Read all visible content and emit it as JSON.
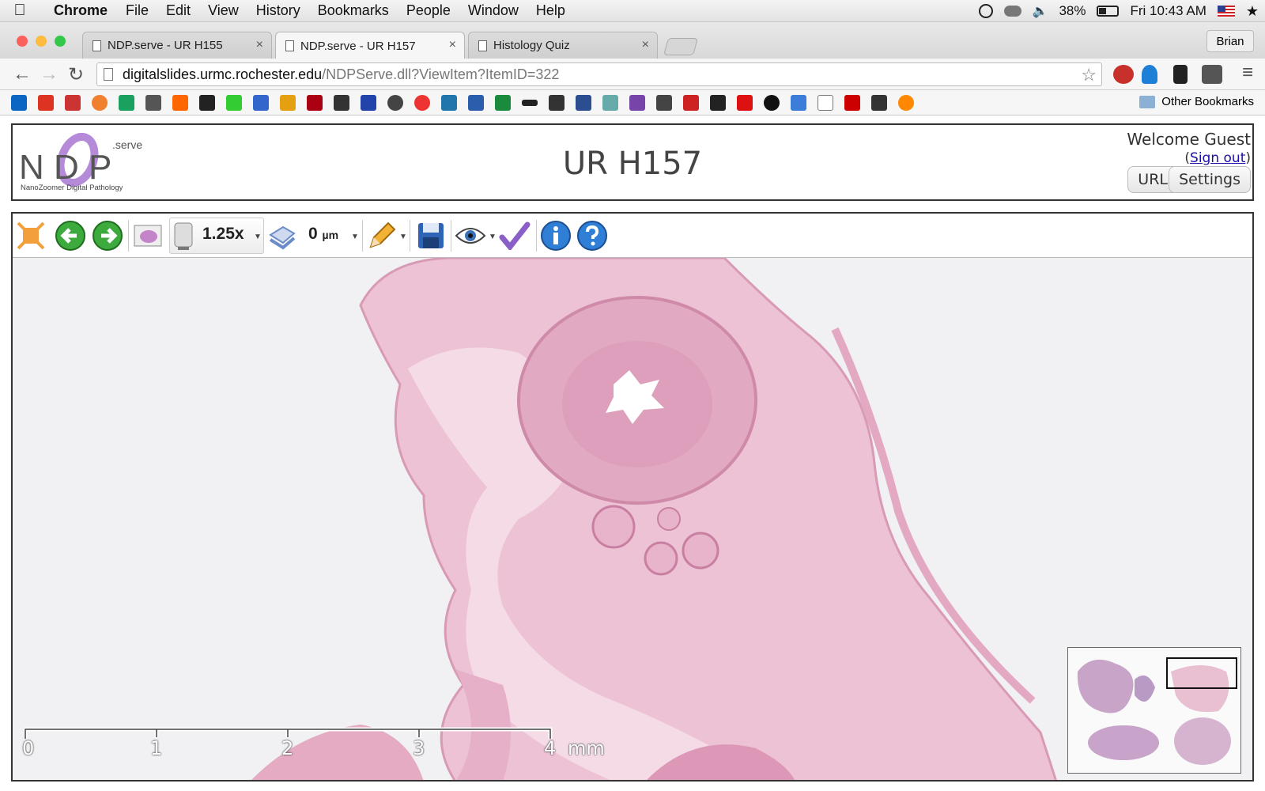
{
  "menubar": {
    "apple_icon": "apple-icon",
    "app_name": "Chrome",
    "menus": [
      "File",
      "Edit",
      "View",
      "History",
      "Bookmarks",
      "People",
      "Window",
      "Help"
    ],
    "battery_percent": "38%",
    "clock": "Fri 10:43 AM"
  },
  "browser": {
    "profile_name": "Brian",
    "tabs": [
      {
        "title": "NDP.serve - UR H155",
        "active": false
      },
      {
        "title": "NDP.serve - UR H157",
        "active": true
      },
      {
        "title": "Histology Quiz",
        "active": false
      }
    ],
    "url_host": "digitalslides.urmc.rochester.edu",
    "url_path": "/NDPServe.dll?ViewItem?ItemID=322",
    "other_bookmarks": "Other Bookmarks",
    "colors": {
      "close": "#fc605c",
      "minimize": "#fdbc40",
      "maximize": "#34c84a"
    }
  },
  "page": {
    "logo_brand": "N D P",
    "logo_suffix": ".serve",
    "logo_tagline": "NanoZoomer Digital Pathology",
    "title": "UR H157",
    "welcome": "Welcome Guest",
    "signout_open": "(",
    "signout_link": "Sign out",
    "signout_close": ")",
    "buttons": {
      "url": "URL",
      "settings": "Settings"
    }
  },
  "viewer": {
    "zoom": "1.25x",
    "depth_value": "0",
    "depth_unit": "µm",
    "scale_ticks": [
      "0",
      "1",
      "2",
      "3",
      "4"
    ],
    "scale_unit": "mm",
    "tissue_color": "#e6b3c9"
  }
}
